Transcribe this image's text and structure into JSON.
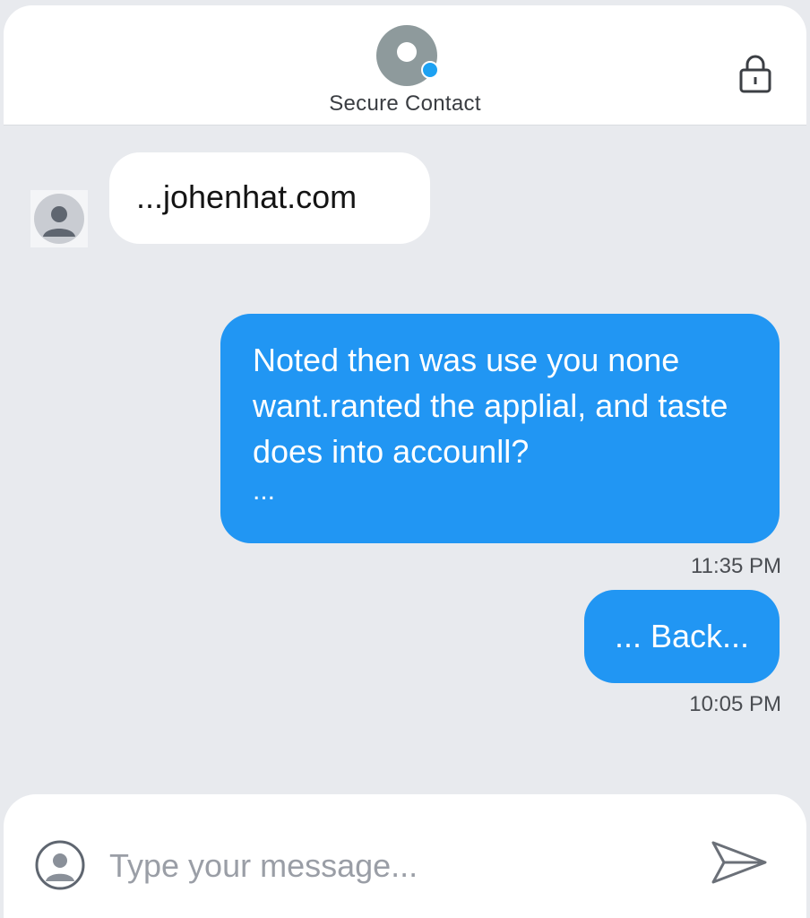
{
  "header": {
    "contact_name": "Secure Contact",
    "avatar_icon": "contact-avatar-icon",
    "status_icon": "online-dot-icon",
    "lock_icon": "lock-icon"
  },
  "messages": [
    {
      "direction": "incoming",
      "text": "...johenhat.com"
    },
    {
      "direction": "outgoing",
      "text": "Noted then was use you none want.ranted the applial, and taste does into accounll?",
      "suffix": "...",
      "time": "11:35 PM"
    },
    {
      "direction": "outgoing",
      "text": "... Back...",
      "time": "10:05 PM"
    }
  ],
  "composer": {
    "placeholder": "Type your message...",
    "send_icon": "send-icon"
  },
  "colors": {
    "accent": "#2196f3",
    "incoming_bubble": "#ffffff",
    "background": "#e8eaee",
    "avatar_gray": "#8e9a9c"
  }
}
